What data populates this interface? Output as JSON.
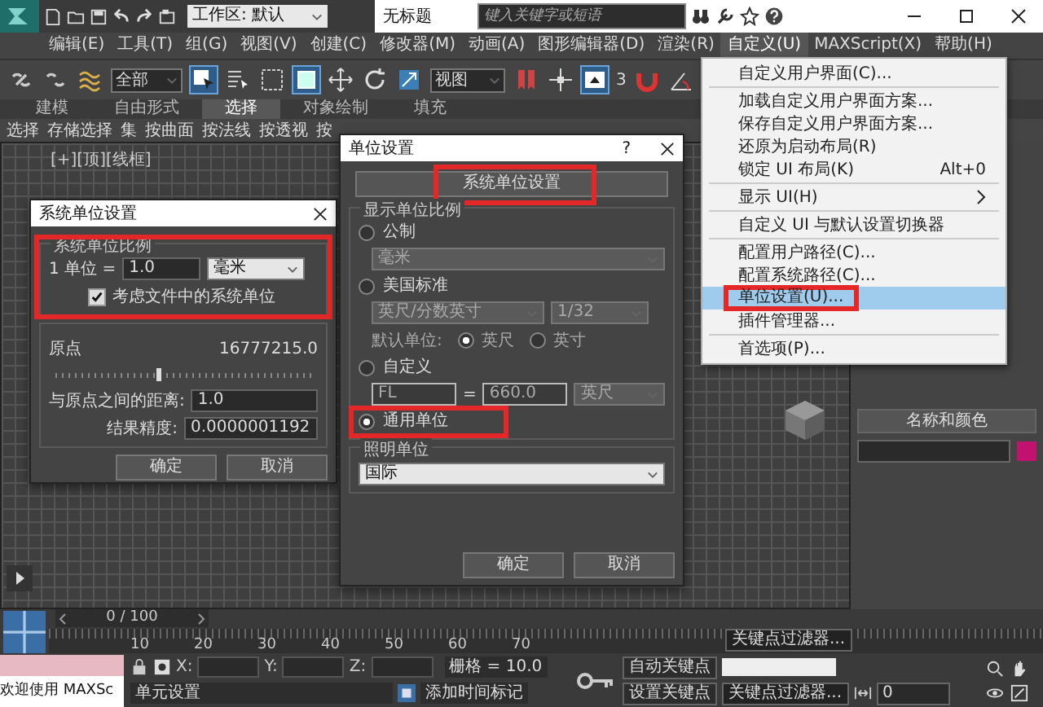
{
  "title_bar": {
    "workspace": "工作区: 默认",
    "title": "无标题",
    "search_placeholder": "键入关键字或短语"
  },
  "menu_bar": [
    {
      "label": "编辑(E)",
      "selected": false
    },
    {
      "label": "工具(T)",
      "selected": false
    },
    {
      "label": "组(G)",
      "selected": false
    },
    {
      "label": "视图(V)",
      "selected": false
    },
    {
      "label": "创建(C)",
      "selected": false
    },
    {
      "label": "修改器(M)",
      "selected": false
    },
    {
      "label": "动画(A)",
      "selected": false
    },
    {
      "label": "图形编辑器(D)",
      "selected": false
    },
    {
      "label": "渲染(R)",
      "selected": false
    },
    {
      "label": "自定义(U)",
      "selected": true
    },
    {
      "label": "MAXScript(X)",
      "selected": false
    },
    {
      "label": "帮助(H)",
      "selected": false
    }
  ],
  "toolbar": {
    "selection_filter": "全部",
    "reference_coord": "视图",
    "snap_label": "3"
  },
  "ribbon": {
    "tabs": [
      {
        "label": "建模",
        "selected": false
      },
      {
        "label": "自由形式",
        "selected": false
      },
      {
        "label": "选择",
        "selected": true
      },
      {
        "label": "对象绘制",
        "selected": false
      },
      {
        "label": "填充",
        "selected": false
      }
    ],
    "items": [
      "选择",
      "存储选择",
      "集",
      "按曲面",
      "按法线",
      "按透视",
      "按"
    ]
  },
  "viewport": {
    "label": "[+][顶][线框]"
  },
  "command_panel": {
    "rollout": "名称和颜色",
    "color": "#c0126e"
  },
  "system_unit_dialog": {
    "title": "系统单位设置",
    "group_title": "系统单位比例",
    "unit_prefix": "1 单位 =",
    "unit_value": "1.0",
    "unit_type": "毫米",
    "respect_checkbox": {
      "label": "考虑文件中的系统单位",
      "checked": true
    },
    "origin_label": "原点",
    "origin_value": "16777215.0",
    "origin_slider": {
      "level": 0.4
    },
    "distance_label": "与原点之间的距离:",
    "distance_value": "1.0",
    "precision_label": "结果精度:",
    "precision_value": "0.0000001192",
    "buttons": [
      "确定",
      "取消"
    ]
  },
  "units_dialog": {
    "title": "单位设置",
    "help": "?",
    "system_button": "系统单位设置",
    "display_group": "显示单位比例",
    "options": [
      {
        "kind": "metric",
        "label": "公制",
        "selected": false,
        "disabled": true,
        "dropdown": "毫米"
      },
      {
        "kind": "us",
        "label": "美国标准",
        "selected": false,
        "disabled": true,
        "dropdown": "英尺/分数英寸",
        "fraction": "1/32",
        "default_label": "默认单位:",
        "defaults": [
          {
            "label": "英尺",
            "selected": true
          },
          {
            "label": "英寸",
            "selected": false
          }
        ]
      },
      {
        "kind": "custom",
        "label": "自定义",
        "selected": false,
        "disabled": true,
        "field1": "FL",
        "equals": "=",
        "field2": "660.0",
        "unit": "英尺"
      },
      {
        "kind": "generic",
        "label": "通用单位",
        "selected": true,
        "disabled": false
      }
    ],
    "lighting_group": "照明单位",
    "lighting_value": "国际",
    "buttons": [
      "确定",
      "取消"
    ]
  },
  "custom_menu": {
    "groups": [
      [
        {
          "label": "自定义用户界面(C)...",
          "submenu": false,
          "selected": false
        }
      ],
      [
        {
          "label": "加载自定义用户界面方案...",
          "submenu": false,
          "selected": false
        },
        {
          "label": "保存自定义用户界面方案...",
          "submenu": false,
          "selected": false
        },
        {
          "label": "还原为启动布局(R)",
          "submenu": false,
          "selected": false
        },
        {
          "label": "锁定 UI 布局(K)",
          "shortcut": "Alt+0",
          "submenu": false,
          "selected": false
        }
      ],
      [
        {
          "label": "显示 UI(H)",
          "submenu": true,
          "selected": false
        }
      ],
      [
        {
          "label": "自定义 UI 与默认设置切换器",
          "submenu": false,
          "selected": false
        }
      ],
      [
        {
          "label": "配置用户路径(C)...",
          "submenu": false,
          "selected": false
        },
        {
          "label": "配置系统路径(C)...",
          "submenu": false,
          "selected": false
        },
        {
          "label": "单位设置(U)...",
          "submenu": false,
          "selected": true
        },
        {
          "label": "插件管理器...",
          "submenu": false,
          "selected": false
        }
      ],
      [
        {
          "label": "首选项(P)...",
          "submenu": false,
          "selected": false
        }
      ]
    ]
  },
  "timeline": {
    "frame": "0 / 100",
    "ticks": [
      "10",
      "20",
      "30",
      "40",
      "50",
      "60",
      "70"
    ],
    "key_filter_top": "关键点过滤器..."
  },
  "status_bar": {
    "welcome": "欢迎使用 MAXSc",
    "prompt": "单元设置",
    "x_label": "X:",
    "y_label": "Y:",
    "z_label": "Z:",
    "grid": "栅格 = 10.0",
    "add_time_tag": "添加时间标记",
    "auto_key": "自动关键点",
    "set_key": "设置关键点",
    "key_filter": "关键点过滤器...",
    "frame_field": "0"
  }
}
